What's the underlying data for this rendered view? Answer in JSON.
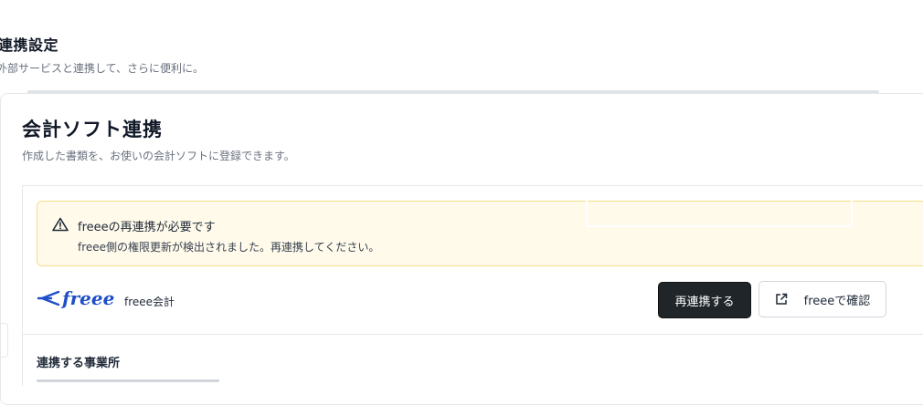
{
  "page": {
    "title": "連携設定",
    "subtitle": "外部サービスと連携して、さらに便利に。"
  },
  "section": {
    "title": "会計ソフト連携",
    "description": "作成した書類を、お使いの会計ソフトに登録できます。"
  },
  "alert": {
    "icon": "warning-triangle-icon",
    "title": "freeeの再連携が必要です",
    "body": "freee側の権限更新が検出されました。再連携してください。",
    "background": "#fffaea",
    "border": "#f3dd8b"
  },
  "integration": {
    "logo_text": "freee",
    "name": "freee会計",
    "reconnect_label": "再連携する",
    "open_label": "freeeで確認",
    "open_icon": "external-link-icon",
    "brand_color": "#1e4fc8",
    "button_dark": "#1f2529"
  },
  "linked_office": {
    "heading": "連携する事業所"
  }
}
